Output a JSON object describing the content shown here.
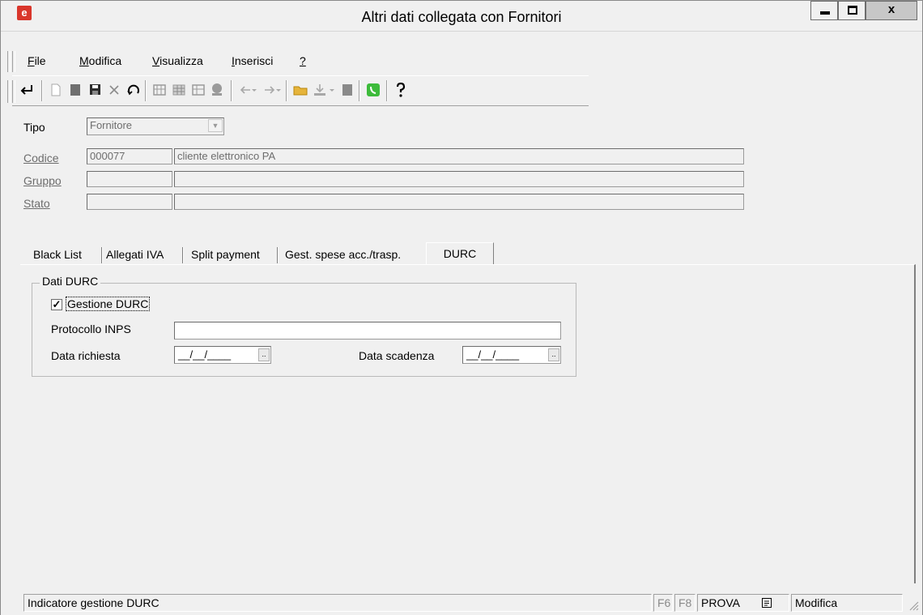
{
  "window": {
    "title": "Altri dati collegata con Fornitori",
    "app_icon_letter": "e",
    "minimize_glyph": "",
    "maximize_glyph": "",
    "close_glyph": "x"
  },
  "menu": {
    "items": [
      {
        "key": "F",
        "rest": "ile"
      },
      {
        "key": "M",
        "rest": "odifica"
      },
      {
        "key": "V",
        "rest": "isualizza"
      },
      {
        "key": "I",
        "rest": "nserisci"
      },
      {
        "key": "?",
        "rest": ""
      }
    ]
  },
  "toolbar": {
    "icons": [
      "return-icon",
      "new-doc-icon",
      "edit-icon",
      "save-icon",
      "delete-icon",
      "refresh-icon",
      "find-icon",
      "grid-icon",
      "filter-icon",
      "search-icon",
      "back-arrow-icon",
      "forward-arrow-icon",
      "folder-icon",
      "download-icon",
      "print-icon",
      "phone-icon",
      "help-icon"
    ],
    "accent_green": "#3dbb3b",
    "accent_yellow": "#e6b43b"
  },
  "header": {
    "tipo_label": "Tipo",
    "tipo_value": "Fornitore",
    "codice_label": "Codice",
    "codice_value": "000077",
    "codice_desc": "cliente elettronico PA",
    "gruppo_label": "Gruppo",
    "gruppo_value": "",
    "gruppo_desc": "",
    "stato_label": "Stato",
    "stato_value": "",
    "stato_desc": ""
  },
  "tabs": {
    "items": [
      "Black List",
      "Allegati IVA",
      "Split payment",
      "Gest. spese acc./trasp."
    ],
    "active": "DURC"
  },
  "durc": {
    "group_title": "Dati DURC",
    "gestione_label": "Gestione DURC",
    "gestione_checked": true,
    "check_mark": "✓",
    "protocollo_label": "Protocollo INPS",
    "protocollo_value": "",
    "data_richiesta_label": "Data richiesta",
    "data_richiesta_value": "__/__/____",
    "data_scadenza_label": "Data scadenza",
    "data_scadenza_value": "__/__/____",
    "date_btn_label": ".."
  },
  "status": {
    "message": "Indicatore gestione DURC",
    "f6": "F6",
    "f8": "F8",
    "env": "PROVA",
    "mode": "Modifica"
  }
}
